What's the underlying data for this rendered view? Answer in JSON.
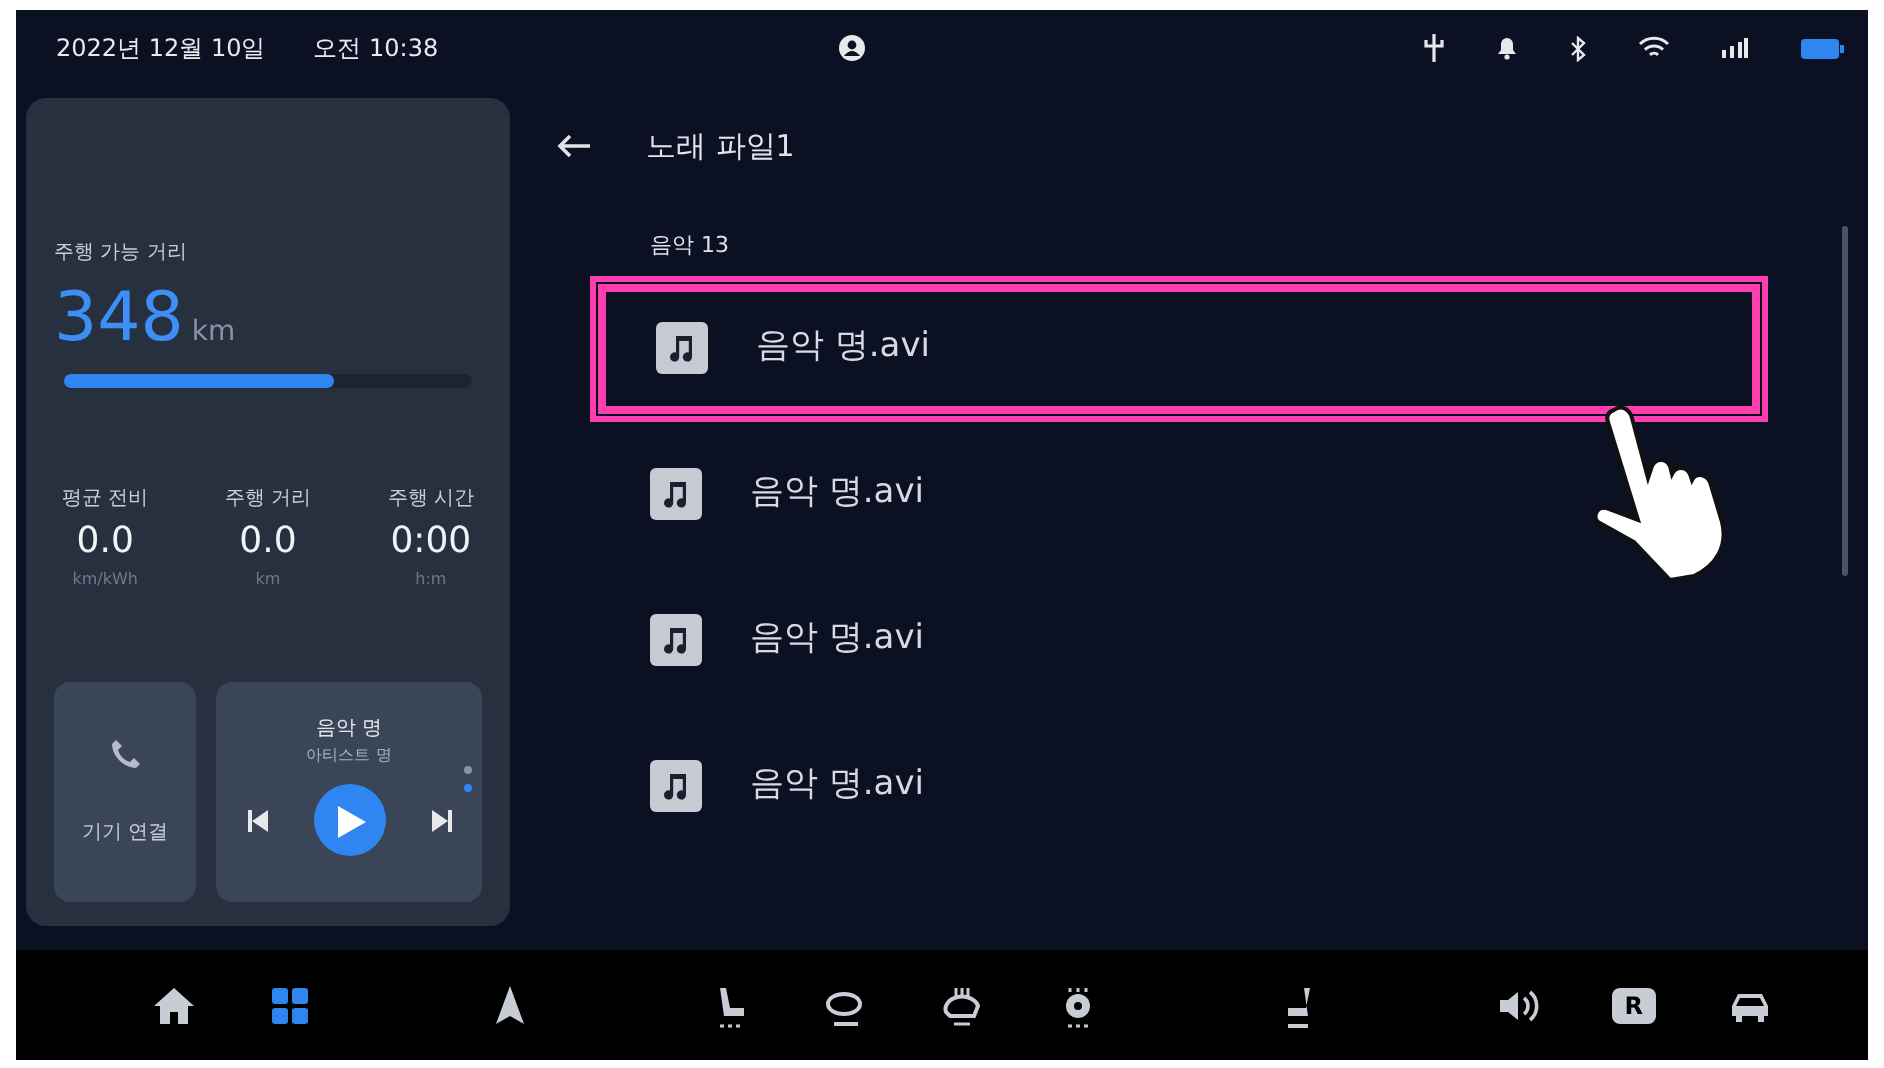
{
  "status_bar": {
    "date": "2022년 12월 10일",
    "time": "오전 10:38"
  },
  "range_card": {
    "label": "주행 가능 거리",
    "value": "348",
    "unit": "km",
    "level": 0.66,
    "stats": [
      {
        "label": "평균 전비",
        "value": "0.0",
        "unit": "km/kWh"
      },
      {
        "label": "주행 거리",
        "value": "0.0",
        "unit": "km"
      },
      {
        "label": "주행 시간",
        "value": "0:00",
        "unit": "h:m"
      }
    ]
  },
  "phone_tile": {
    "label": "기기 연결"
  },
  "music_tile": {
    "title": "음악 명",
    "artist": "아티스트 명",
    "playing": false,
    "pages": [
      {
        "selected": false
      },
      {
        "selected": true
      }
    ]
  },
  "file_list": {
    "title": "노래 파일1",
    "section": "음악 13",
    "files": [
      {
        "name": "음악 명.avi",
        "selected": true
      },
      {
        "name": "음악 명.avi",
        "selected": false
      },
      {
        "name": "음악 명.avi",
        "selected": false
      },
      {
        "name": "음악 명.avi",
        "selected": false
      }
    ]
  },
  "dock": [
    {
      "kind": "home",
      "selected": false
    },
    {
      "kind": "apps",
      "selected": true
    },
    {
      "kind": "nav",
      "selected": false
    },
    {
      "kind": "seat",
      "selected": false
    },
    {
      "kind": "wheel",
      "selected": false
    },
    {
      "kind": "heat",
      "selected": false
    },
    {
      "kind": "fan",
      "selected": false
    },
    {
      "kind": "seat2",
      "selected": false
    },
    {
      "kind": "volume",
      "selected": false
    },
    {
      "kind": "gear",
      "label": "R",
      "selected": false
    },
    {
      "kind": "car",
      "selected": false
    }
  ]
}
